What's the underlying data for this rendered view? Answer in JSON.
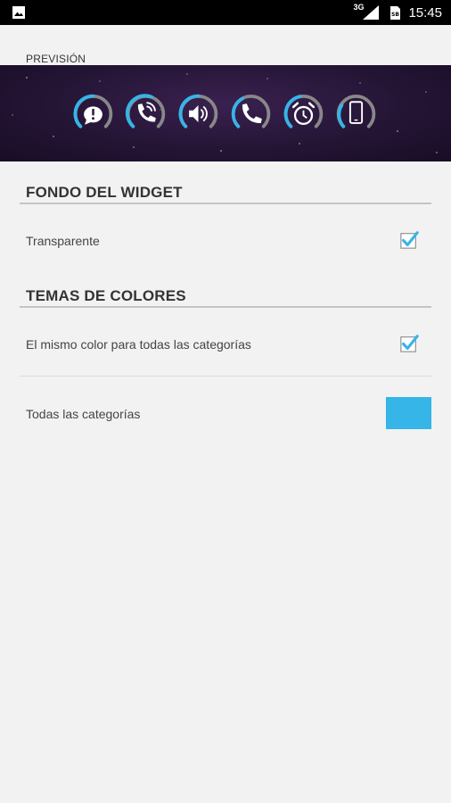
{
  "status_bar": {
    "network": "3G",
    "sim": "SB",
    "time": "15:45"
  },
  "preview": {
    "label": "PREVISIÓN",
    "icons": [
      "sms-icon",
      "missed-call-icon",
      "volume-icon",
      "call-icon",
      "alarm-icon",
      "phone-icon"
    ]
  },
  "sections": {
    "widget_background": {
      "title": "FONDO DEL WIDGET",
      "transparent_label": "Transparente",
      "transparent_checked": true
    },
    "color_themes": {
      "title": "TEMAS DE COLORES",
      "same_color_label": "El mismo color para todas las categorías",
      "same_color_checked": true,
      "all_categories_label": "Todas las categorías",
      "all_categories_color": "#35b5e8"
    }
  },
  "colors": {
    "accent": "#35b5e8",
    "gauge_inactive": "#888888"
  }
}
